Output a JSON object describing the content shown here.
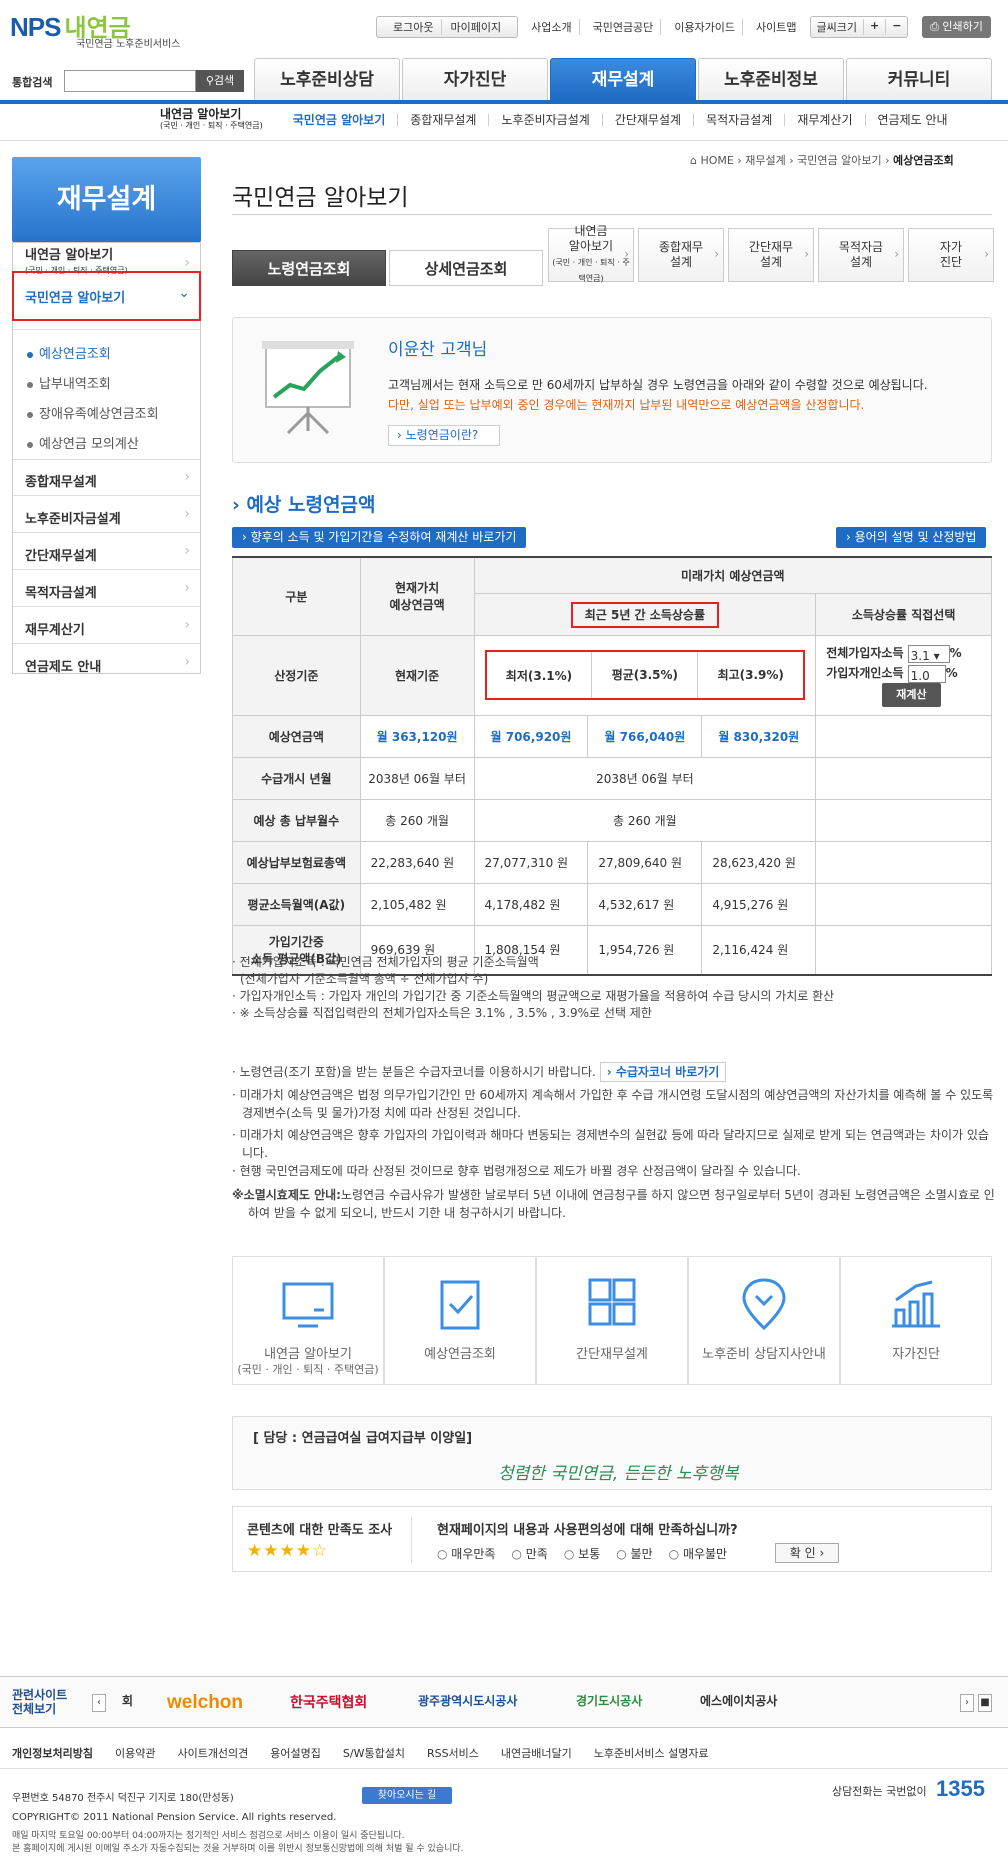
{
  "header": {
    "logo_main": "NPS",
    "logo_ko": "내연금",
    "logo_sub": "국민연금 노후준비서비스",
    "util_login": [
      "로그아웃",
      "마이페이지"
    ],
    "util_links": [
      "사업소개",
      "국민연금공단",
      "이용자가이드",
      "사이트맵"
    ],
    "font_label": "글씨크기",
    "font_plus": "+",
    "font_minus": "−",
    "print": "인쇄하기",
    "search_label": "통합검색",
    "search_btn": "검색",
    "gnb": [
      "노후준비상담",
      "자가진단",
      "재무설계",
      "노후준비정보",
      "커뮤니티"
    ],
    "sub_title": "내연금 알아보기",
    "sub_title_small": "(국민 · 개인 · 퇴직 · 주택연금)",
    "sub_items": [
      "국민연금 알아보기",
      "종합재무설계",
      "노후준비자금설계",
      "간단재무설계",
      "목적자금설계",
      "재무계산기",
      "연금제도 안내"
    ]
  },
  "lnb": {
    "title": "재무설계",
    "item1": "내연금 알아보기",
    "item1_small": "(국민 · 개인 · 퇴직 · 주택연금)",
    "item2": "국민연금 알아보기",
    "subs": [
      "예상연금조회",
      "납부내역조회",
      "장애유족예상연금조회",
      "예상연금 모의계산"
    ],
    "items": [
      "종합재무설계",
      "노후준비자금설계",
      "간단재무설계",
      "목적자금설계",
      "재무계산기",
      "연금제도 안내"
    ]
  },
  "bread": {
    "home": "HOME",
    "b1": "재무설계",
    "b2": "국민연금 알아보기",
    "cur": "예상연금조회"
  },
  "page_title": "국민연금 알아보기",
  "tabs": [
    "노령연금조회",
    "상세연금조회"
  ],
  "minitabs": [
    {
      "a": "내연금",
      "b": "알아보기",
      "c": "(국민 · 개인 · 퇴직 · 주택연금)"
    },
    {
      "a": "종합재무",
      "b": "설계"
    },
    {
      "a": "간단재무",
      "b": "설계"
    },
    {
      "a": "목적자금",
      "b": "설계"
    },
    {
      "a": "자가",
      "b": "진단"
    }
  ],
  "intro": {
    "name": "이윤찬 고객님",
    "p1": "고객님께서는 현재 소득으로 만 60세까지 납부하실 경우 노령연금을 아래와 같이 수령할 것으로 예상됩니다.",
    "p2": "다만, 실업 또는 납부예외 중인 경우에는 현재까지 납부된 내역만으로 예상연금액을 산정합니다.",
    "btn": "노령연금이란?"
  },
  "section": {
    "title": "예상 노령연금액",
    "btn_left": "향후의 소득 및 가입기간을 수정하여 재계산 바로가기",
    "btn_right": "용어의 설명 및 산정방법"
  },
  "table": {
    "h_gubun": "구분",
    "h_cur1": "현재가치",
    "h_cur2": "예상연금액",
    "h_future": "미래가치 예상연금액",
    "h_recent": "최근 5년 간 소득상승률",
    "h_direct": "소득상승률 직접선택",
    "r_basis": "산정기준",
    "cur_basis": "현재기준",
    "low": "최저(3.1%)",
    "avg": "평균(3.5%)",
    "high": "최고(3.9%)",
    "in_all": "전체가입자소득",
    "in_all_val": "3.1",
    "in_ind": "가입자개인소득",
    "in_ind_val": "1.0",
    "pct": "%",
    "recalc": "재계산",
    "rows": [
      {
        "label": "예상연금액",
        "cur": "월 363,120원",
        "low": "월 706,920원",
        "avg": "월 766,040원",
        "high": "월 830,320원"
      },
      {
        "label": "수급개시 년월",
        "cur": "2038년 06월 부터",
        "merged": "2038년 06월 부터"
      },
      {
        "label": "예상 총 납부월수",
        "cur": "총 260 개월",
        "merged": "총 260 개월"
      },
      {
        "label": "예상납부보험료총액",
        "cur": "22,283,640 원",
        "low": "27,077,310 원",
        "avg": "27,809,640 원",
        "high": "28,623,420 원"
      },
      {
        "label": "평균소득월액(A값)",
        "cur": "2,105,482 원",
        "low": "4,178,482 원",
        "avg": "4,532,617 원",
        "high": "4,915,276 원"
      },
      {
        "label": "가입기간중",
        "label2": "소득 평균액(B값)",
        "cur": "969,639 원",
        "low": "1,808,154 원",
        "avg": "1,954,726 원",
        "high": "2,116,424 원"
      }
    ]
  },
  "notes1": [
    "· 전체가입자소득 : 국민연금 전체가입자의 평균 기준소득월액",
    "  (전체가입자 기준소득월액 총액 ÷ 전체가입자 수)",
    "· 가입자개인소득 : 가입자 개인의 가입기간 중 기준소득월액의 평균액으로 재평가율을 적용하여 수급 당시의 가치로 환산",
    "· ※ 소득상승률 직접입력란의 전체가입자소득은 3.1% , 3.5% , 3.9%로 선택 제한"
  ],
  "notes2": {
    "n1": "· 노령연금(조기 포함)을 받는 분들은 수급자코너를 이용하시기 바랍니다.",
    "n1btn": "수급자코너 바로가기",
    "n2": "· 미래가치 예상연금액은 법정 의무가입기간인 만 60세까지 계속해서 가입한 후 수급 개시연령 도달시점의 예상연금액의 자산가치를 예측해 볼 수 있도록 경제변수(소득 및 물가)가정 치에 따라 산정된 것입니다.",
    "n3": "· 미래가치 예상연금액은 향후 가입자의 가입이력과 해마다 변동되는 경제변수의 실현값 등에 따라 달라지므로 실제로 받게 되는 연금액과는 차이가 있습니다.",
    "n4": "· 현행 국민연금제도에 따라 산정된 것이므로 향후 법령개정으로 제도가 바뀔 경우 산정금액이 달라질 수 있습니다.",
    "n5b": "※소멸시효제도 안내:",
    "n5": "노령연금 수급사유가 발생한 날로부터 5년 이내에 연금청구를 하지 않으면 청구일로부터 5년이 경과된 노령연금액은 소멸시효로 인하여 받을 수 없게 되오니, 반드시 기한 내 청구하시기 바랍니다."
  },
  "quick": [
    {
      "a": "내연금 알아보기",
      "b": "(국민 · 개인 · 퇴직 · 주택연금)"
    },
    {
      "a": "예상연금조회"
    },
    {
      "a": "간단재무설계"
    },
    {
      "a": "노후준비 상담지사안내"
    },
    {
      "a": "자가진단"
    }
  ],
  "contact": {
    "title": "[ 담당 : 연금급여실 급여지급부 이양일]",
    "slogan": "청렴한 국민연금, 든든한 노후행복"
  },
  "survey": {
    "title": "콘텐츠에 대한 만족도 조사",
    "stars": "★★★★☆",
    "question": "현재페이지의 내용과 사용편의성에 대해 만족하십니까?",
    "options": [
      "매우만족",
      "만족",
      "보통",
      "불만",
      "매우불만"
    ],
    "ok": "확 인"
  },
  "footer": {
    "rel1": "관련사이트",
    "rel2": "전체보기",
    "sites": [
      "회",
      "welchon",
      "한국주택협회",
      "광주광역시도시공사",
      "경기도시공사",
      "에스에이치공사"
    ],
    "links": [
      "개인정보처리방침",
      "이용약관",
      "사이트개선의견",
      "용어설명집",
      "S/W통합설치",
      "RSS서비스",
      "내연금배너달기",
      "노후준비서비스 설명자료"
    ],
    "addr": "우편번호 54870   전주시 덕진구 기지로 180(만성동)",
    "map": "찾아오시는 길",
    "copy": "COPYRIGHT© 2011 National Pension Service. All rights reserved.",
    "note1": "매일 마지막 토요일 00:00부터 04:00까지는 정기적인 서비스 점검으로 서비스 이용이 일시 중단됩니다.",
    "note2": "본 홈페이지에 게시된 이메일 주소가 자동수집되는 것을 거부하며 이를 위반시 정보통신망법에 의해 처벌 될 수 있습니다.",
    "call": "상담전화는 국번없이",
    "num": "1355"
  },
  "colors": {
    "accent": "#1f6cc4",
    "highlight_box": "#e32222"
  }
}
